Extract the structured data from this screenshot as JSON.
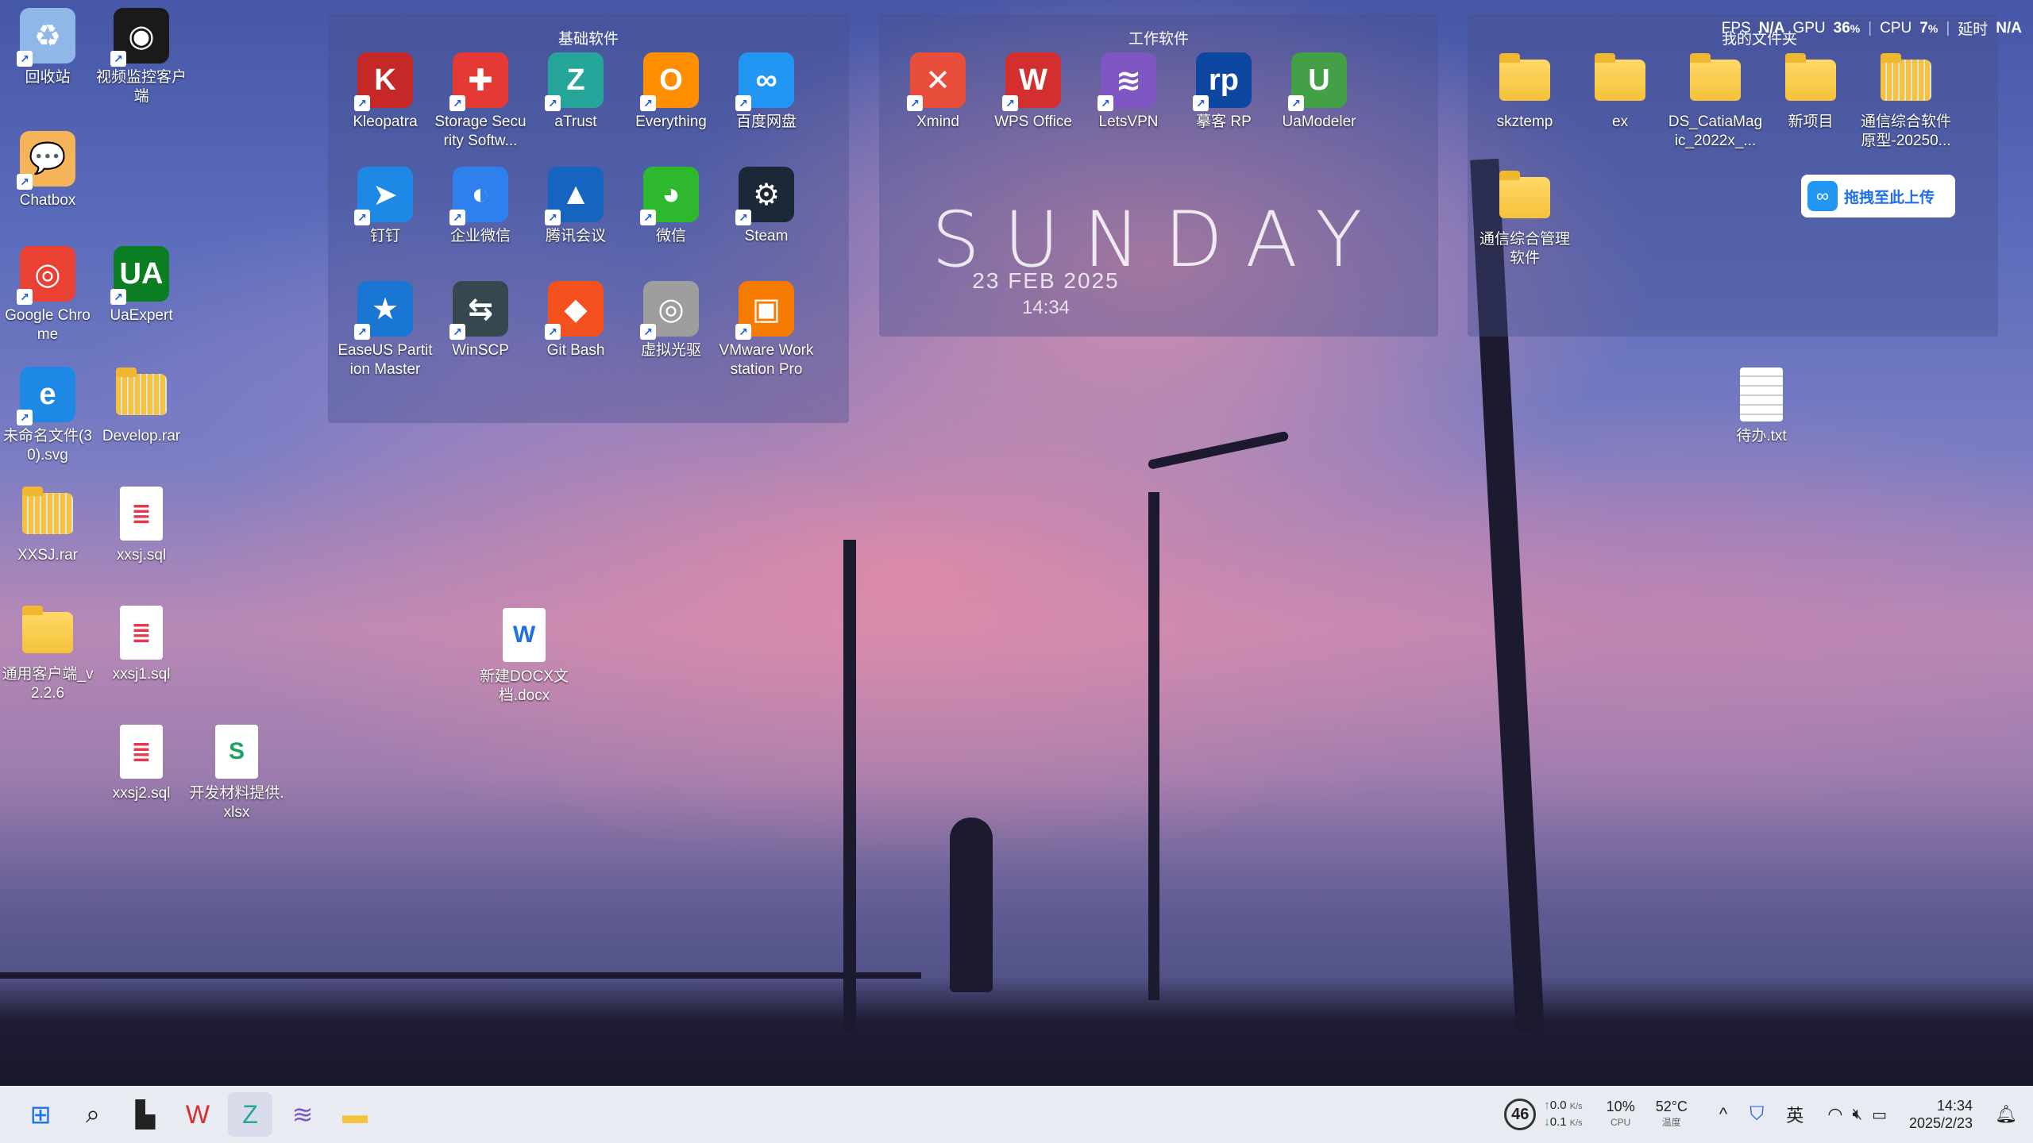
{
  "desktop_left": [
    {
      "label": "回收站",
      "icon": "recycle-bin-icon",
      "glyph": "♻",
      "bg": "#8fb8e8"
    },
    {
      "label": "视频监控客户端",
      "icon": "camera-icon",
      "glyph": "◉",
      "bg": "#1a1a1a"
    },
    {
      "label": "Chatbox",
      "icon": "chatbox-icon",
      "glyph": "💬",
      "bg": "#f5b35a"
    },
    {
      "label": "Google Chrome",
      "icon": "chrome-icon",
      "glyph": "◎",
      "bg": "#e94235"
    },
    {
      "label": "UaExpert",
      "icon": "uaexpert-icon",
      "glyph": "UA",
      "bg": "#0b7d22"
    },
    {
      "label": "未命名文件(30).svg",
      "icon": "edge-icon",
      "glyph": "e",
      "bg": "#1e88e5"
    },
    {
      "label": "Develop.rar",
      "icon": "zip-folder-icon",
      "glyph": "",
      "bg": ""
    },
    {
      "label": "XXSJ.rar",
      "icon": "zip-folder-icon",
      "glyph": "",
      "bg": ""
    },
    {
      "label": "xxsj.sql",
      "icon": "sql-file-icon",
      "glyph": "≣",
      "bg": "#fff"
    },
    {
      "label": "通用客户端_v2.2.6",
      "icon": "folder-icon",
      "glyph": "",
      "bg": ""
    },
    {
      "label": "xxsj1.sql",
      "icon": "sql-file-icon",
      "glyph": "≣",
      "bg": "#fff"
    },
    {
      "label": "xxsj2.sql",
      "icon": "sql-file-icon",
      "glyph": "≣",
      "bg": "#fff"
    },
    {
      "label": "开发材料提供.xlsx",
      "icon": "xlsx-file-icon",
      "glyph": "S",
      "bg": "#fff"
    },
    {
      "label": "新建DOCX文档.docx",
      "icon": "docx-file-icon",
      "glyph": "W",
      "bg": "#fff"
    },
    {
      "label": "待办.txt",
      "icon": "txt-file-icon",
      "glyph": "",
      "bg": "#fff"
    }
  ],
  "fence_basic": {
    "title": "基础软件",
    "items": [
      {
        "label": "Kleopatra",
        "icon": "kleopatra-icon",
        "glyph": "K",
        "bg": "#c62828"
      },
      {
        "label": "Storage Security Softw...",
        "icon": "storage-security-icon",
        "glyph": "✚",
        "bg": "#e53935"
      },
      {
        "label": "aTrust",
        "icon": "atrust-icon",
        "glyph": "Z",
        "bg": "#26a69a"
      },
      {
        "label": "Everything",
        "icon": "everything-icon",
        "glyph": "O",
        "bg": "#ff8f00"
      },
      {
        "label": "百度网盘",
        "icon": "baidu-netdisk-icon",
        "glyph": "∞",
        "bg": "#2196f3"
      },
      {
        "label": "钉钉",
        "icon": "dingtalk-icon",
        "glyph": "➤",
        "bg": "#1e88e5"
      },
      {
        "label": "企业微信",
        "icon": "wecom-icon",
        "glyph": "◐",
        "bg": "#2f80ed"
      },
      {
        "label": "腾讯会议",
        "icon": "tencent-meeting-icon",
        "glyph": "▲",
        "bg": "#1565c0"
      },
      {
        "label": "微信",
        "icon": "wechat-icon",
        "glyph": "◕",
        "bg": "#2eb82e"
      },
      {
        "label": "Steam",
        "icon": "steam-icon",
        "glyph": "⚙",
        "bg": "#1b2838"
      },
      {
        "label": "EaseUS Partition Master",
        "icon": "easeus-icon",
        "glyph": "★",
        "bg": "#1976d2"
      },
      {
        "label": "WinSCP",
        "icon": "winscp-icon",
        "glyph": "⇆",
        "bg": "#37474f"
      },
      {
        "label": "Git Bash",
        "icon": "git-bash-icon",
        "glyph": "◆",
        "bg": "#f4511e"
      },
      {
        "label": "虚拟光驱",
        "icon": "virtual-drive-icon",
        "glyph": "◎",
        "bg": "#9e9e9e"
      },
      {
        "label": "VMware Workstation Pro",
        "icon": "vmware-icon",
        "glyph": "▣",
        "bg": "#f57c00"
      }
    ]
  },
  "fence_work": {
    "title": "工作软件",
    "items": [
      {
        "label": "Xmind",
        "icon": "xmind-icon",
        "glyph": "✕",
        "bg": "#e94e3c"
      },
      {
        "label": "WPS Office",
        "icon": "wps-icon",
        "glyph": "W",
        "bg": "#d32f2f"
      },
      {
        "label": "LetsVPN",
        "icon": "letsvpn-icon",
        "glyph": "≋",
        "bg": "#7e57c2"
      },
      {
        "label": "摹客 RP",
        "icon": "mockplus-icon",
        "glyph": "rp",
        "bg": "#0d47a1"
      },
      {
        "label": "UaModeler",
        "icon": "uamodeler-icon",
        "glyph": "U",
        "bg": "#43a047"
      }
    ],
    "day": "SUNDAY",
    "date": "23 FEB 2025",
    "time": "14:34"
  },
  "fence_files": {
    "title": "我的文件夹",
    "items": [
      {
        "label": "skztemp",
        "icon": "folder-icon"
      },
      {
        "label": "ex",
        "icon": "folder-icon"
      },
      {
        "label": "DS_CatiaMagic_2022x_...",
        "icon": "folder-icon"
      },
      {
        "label": "新项目",
        "icon": "folder-icon"
      },
      {
        "label": "通信综合软件原型-20250...",
        "icon": "zip-folder-icon"
      },
      {
        "label": "通信综合管理软件",
        "icon": "folder-icon"
      }
    ],
    "upload_label": "拖拽至此上传"
  },
  "perf": {
    "fps_label": "FPS",
    "fps": "N/A",
    "gpu_label": "GPU",
    "gpu": "36",
    "cpu_label": "CPU",
    "cpu": "7",
    "delay_label": "延时",
    "delay": "N/A",
    "percent": "%"
  },
  "taskbar": {
    "apps": [
      {
        "name": "start-button",
        "glyph": "⊞",
        "color": "#1a73e8"
      },
      {
        "name": "search-button",
        "glyph": "⌕",
        "color": "#222"
      },
      {
        "name": "task-view-button",
        "glyph": "▙",
        "color": "#222"
      },
      {
        "name": "wps-taskbar-button",
        "glyph": "W",
        "color": "#d32f2f"
      },
      {
        "name": "atrust-taskbar-button",
        "glyph": "Z",
        "color": "#26a69a"
      },
      {
        "name": "letsvpn-taskbar-button",
        "glyph": "≋",
        "color": "#7e57c2"
      },
      {
        "name": "file-explorer-button",
        "glyph": "▬",
        "color": "#f5c23b"
      }
    ],
    "badge": "46",
    "net_up": "0.0",
    "net_down": "0.1",
    "net_unit": "K/s",
    "cpu_pct": "10%",
    "cpu_label": "CPU",
    "temp": "52°C",
    "temp_label": "温度",
    "ime": "英",
    "clock_time": "14:34",
    "clock_date": "2025/2/23"
  }
}
